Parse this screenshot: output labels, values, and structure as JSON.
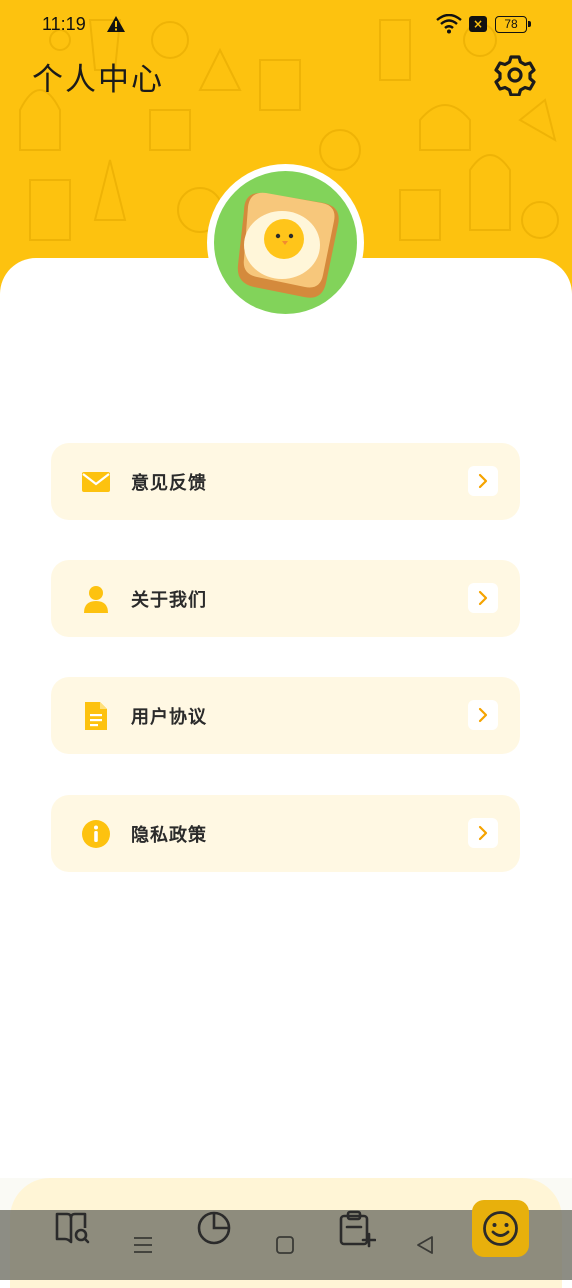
{
  "status_bar": {
    "time": "11:19",
    "battery": "78",
    "sim": "×",
    "icons": [
      "warning-icon",
      "wifi-icon",
      "no-sim-icon",
      "battery-icon"
    ]
  },
  "header": {
    "title": "个人中心",
    "settings_icon": "gear-icon",
    "background_color": "#FDC20F"
  },
  "avatar": {
    "icon": "egg-toast-avatar",
    "ring_color": "#82D35A"
  },
  "menu": {
    "items": [
      {
        "label": "意见反馈",
        "icon": "mail-icon"
      },
      {
        "label": "关于我们",
        "icon": "person-icon"
      },
      {
        "label": "用户协议",
        "icon": "document-icon"
      },
      {
        "label": "隐私政策",
        "icon": "info-icon"
      }
    ],
    "accent_color": "#FDC20F",
    "item_background": "#FFF8E3"
  },
  "bottom_tabs": [
    {
      "icon": "book-search-icon"
    },
    {
      "icon": "pie-chart-icon"
    },
    {
      "icon": "clipboard-add-icon"
    },
    {
      "icon": "smile-icon",
      "active": true
    }
  ],
  "system_nav": [
    "menu-nav-icon",
    "home-nav-icon",
    "back-nav-icon"
  ]
}
